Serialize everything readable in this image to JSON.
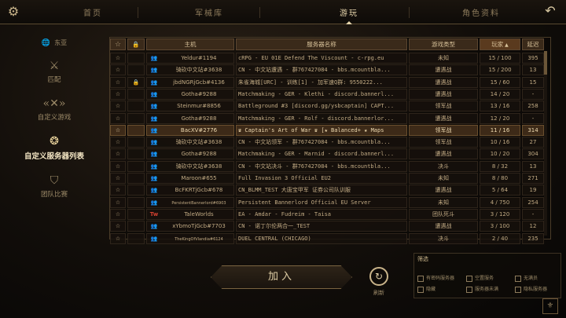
{
  "top_tabs": [
    "首页",
    "军械库",
    "游玩",
    "角色资料"
  ],
  "active_tab": "游玩",
  "left_menu": [
    {
      "label": "东亚",
      "icon": "globe-icon"
    },
    {
      "label": "匹配",
      "icon": "crossed-swords-icon"
    },
    {
      "label": "自定义游戏",
      "icon": "custom-game-icon"
    },
    {
      "label": "自定义服务器列表",
      "icon": "server-list-icon"
    },
    {
      "label": "团队比赛",
      "icon": "shield-icon"
    }
  ],
  "table": {
    "headers": {
      "host": "主机",
      "server": "服务器名称",
      "gametype": "游戏类型",
      "players": "玩家",
      "ping": "延迟"
    },
    "rows": [
      {
        "host": "Yeldur#1194",
        "server": "cRPG - EU 01E Defend The Viscount - c-rpg.eu",
        "gametype": "未知",
        "players": "15 / 100",
        "ping": "395",
        "locked": false,
        "icon": "group"
      },
      {
        "host": "骑砍中文站#3638",
        "server": "CN - 中文站遭遇 - 群767427084 - bbs.mcountbla...",
        "gametype": "遭遇战",
        "players": "15 / 200",
        "ping": "13",
        "locked": false,
        "icon": "group"
      },
      {
        "host": "jbdNGRjGcb#4136",
        "server": "朱雀海城[URC] - 训练[1] - 加军速Q群: 9550222...",
        "gametype": "遭遇战",
        "players": "15 / 60",
        "ping": "15",
        "locked": true,
        "icon": "group"
      },
      {
        "host": "Gotha#9288",
        "server": "Matchmaking - GER - Klethi - discord.bannerl...",
        "gametype": "遭遇战",
        "players": "14 / 20",
        "ping": "-",
        "locked": false,
        "icon": "group"
      },
      {
        "host": "Steinmur#8856",
        "server": "Battleground #3 [discord.gg/ysbcaptain] CAPT...",
        "gametype": "领军战",
        "players": "13 / 16",
        "ping": "258",
        "locked": false,
        "icon": "group"
      },
      {
        "host": "Gotha#9288",
        "server": "Matchmaking - GER - Rolf - discord.bannerlor...",
        "gametype": "遭遇战",
        "players": "12 / 20",
        "ping": "-",
        "locked": false,
        "icon": "group"
      },
      {
        "host": "BacXV#2776",
        "server": "♛ Captain's Art of War ♛ [★ Balanced+ ★ Maps",
        "gametype": "领军战",
        "players": "11 / 16",
        "ping": "314",
        "locked": false,
        "icon": "group",
        "highlight": true
      },
      {
        "host": "骑砍中文站#3638",
        "server": "CN - 中文站领军 - 群767427084 - bbs.mcountbla...",
        "gametype": "领军战",
        "players": "10 / 16",
        "ping": "27",
        "locked": false,
        "icon": "group"
      },
      {
        "host": "Gotha#9288",
        "server": "Matchmaking - GER - Marnid - discord.bannerl...",
        "gametype": "遭遇战",
        "players": "10 / 20",
        "ping": "304",
        "locked": false,
        "icon": "group"
      },
      {
        "host": "骑砍中文站#3638",
        "server": "CN - 中文站决斗 - 群767427084 - bbs.mcountbla...",
        "gametype": "决斗",
        "players": "8 / 32",
        "ping": "13",
        "locked": false,
        "icon": "group"
      },
      {
        "host": "Maroon#655",
        "server": "Full Invasion 3 Official EU2",
        "gametype": "未知",
        "players": "8 / 80",
        "ping": "271",
        "locked": false,
        "icon": "group"
      },
      {
        "host": "BcFKRTjGcb#678",
        "server": "CN_BLMM_TEST 大唐宝甲军 证券公司队训服",
        "gametype": "遭遇战",
        "players": "5 / 64",
        "ping": "19",
        "locked": false,
        "icon": "group"
      },
      {
        "host": "PersistentBannerlord#6903",
        "server": "Persistent Bannerlord Official EU Server",
        "gametype": "未知",
        "players": "4 / 750",
        "ping": "254",
        "locked": false,
        "icon": "group"
      },
      {
        "host": "TaleWorlds",
        "server": "EA - Amdar - Fudreim - Taisa",
        "gametype": "团队死斗",
        "players": "3 / 120",
        "ping": "-",
        "locked": false,
        "icon": "taleworlds"
      },
      {
        "host": "xYbmoTjGcb#7703",
        "server": "CN - 诺丁尔伦两合一_TEST",
        "gametype": "遭遇战",
        "players": "3 / 100",
        "ping": "12",
        "locked": false,
        "icon": "group"
      },
      {
        "host": "TheKingOfVlandia#6124",
        "server": "DUEL CENTRAL (CHICAGO)",
        "gametype": "决斗",
        "players": "2 / 40",
        "ping": "235",
        "locked": false,
        "icon": "group"
      }
    ]
  },
  "join_label": "加入",
  "refresh_label": "刷新",
  "filter": {
    "title": "筛选",
    "options": [
      "有密码服务器",
      "空置服务",
      "无满员",
      "隐藏",
      "服务器未满",
      "隐私服务器"
    ]
  }
}
